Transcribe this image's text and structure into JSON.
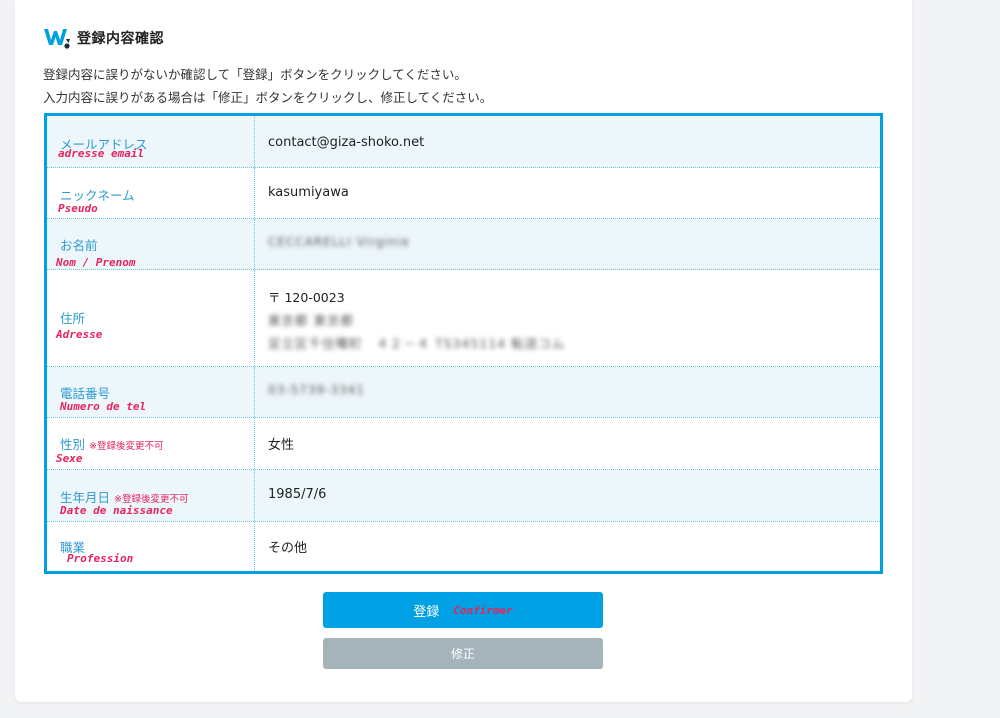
{
  "heading": {
    "title": "登録内容確認"
  },
  "intro": {
    "line1": "登録内容に誤りがないか確認して「登録」ボタンをクリックしてください。",
    "line2": "入力内容に誤りがある場合は「修正」ボタンをクリックし、修正してください。"
  },
  "rows": [
    {
      "label": "メールアドレス",
      "annotation": "adresse email",
      "value": "contact@giza-shoko.net"
    },
    {
      "label": "ニックネーム",
      "annotation": "Pseudo",
      "value": "kasumiyawa"
    },
    {
      "label": "お名前",
      "annotation": "Nom / Prenom",
      "value": "CECCARELLI Virginie"
    },
    {
      "label": "住所",
      "annotation": "Adresse",
      "address": {
        "postal": "〒 120-0023",
        "line2": "東京都 東京都",
        "line3": "足立区千住曙町　４２－４ TS345114 転送コム"
      }
    },
    {
      "label": "電話番号",
      "annotation": "Numero de tel",
      "value": "03-5739-3341"
    },
    {
      "label": "性別",
      "note": "※登録後変更不可",
      "annotation": "Sexe",
      "value": "女性"
    },
    {
      "label": "生年月日",
      "note": "※登録後変更不可",
      "annotation": "Date de naissance",
      "value": "1985/7/6"
    },
    {
      "label": "職業",
      "annotation": "Profession",
      "value": "その他"
    }
  ],
  "buttons": {
    "register": "登録",
    "register_annotation": "Confirmer",
    "modify": "修正"
  },
  "colors": {
    "accent": "#00a1e4",
    "annotation": "#e5245e",
    "label": "#2c9bd1",
    "secondary_button": "#a5b3bb"
  }
}
